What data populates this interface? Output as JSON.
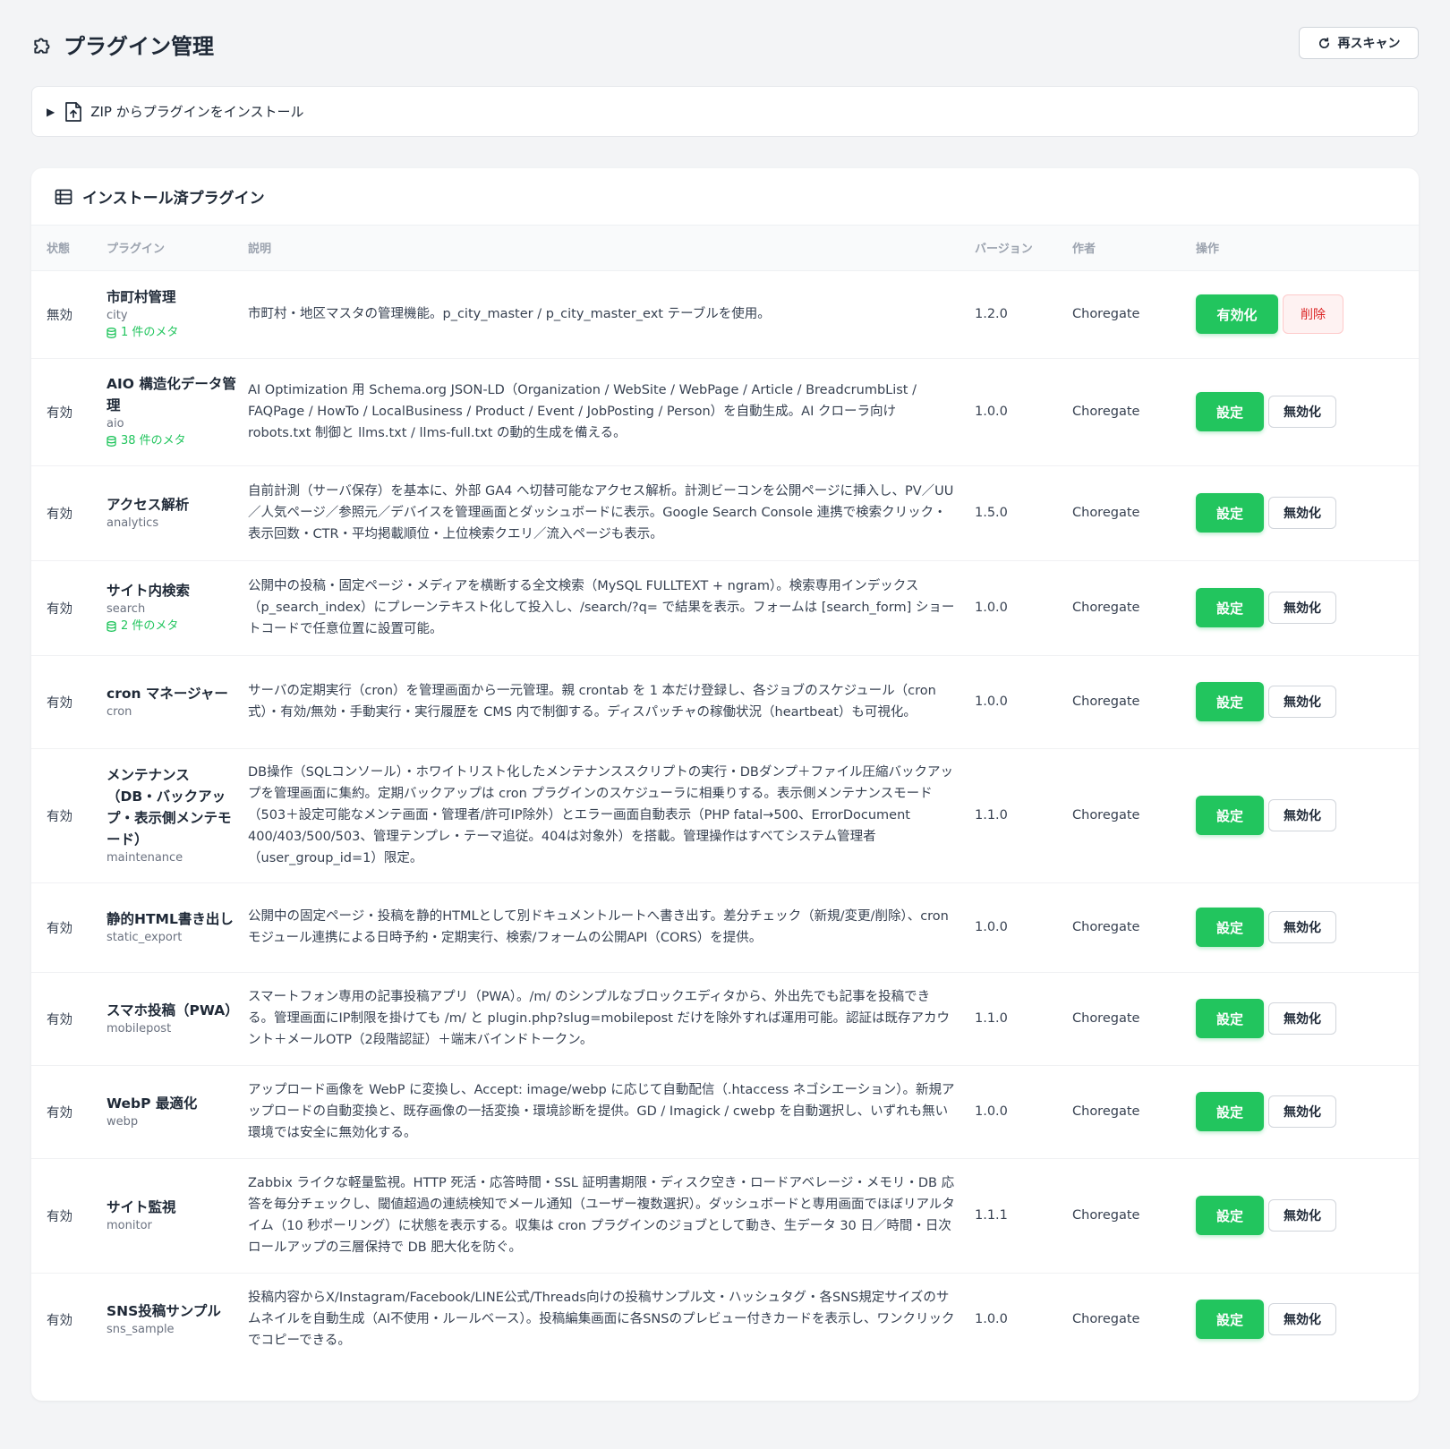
{
  "header": {
    "title": "プラグイン管理",
    "rescan_label": "再スキャン"
  },
  "zip_install": {
    "label": "ZIP からプラグインをインストール"
  },
  "installed": {
    "title": "インストール済プラグイン",
    "columns": [
      "状態",
      "プラグイン",
      "説明",
      "バージョン",
      "作者",
      "操作"
    ],
    "rows": [
      {
        "status": "無効",
        "name": "市町村管理",
        "slug": "city",
        "meta": "1 件のメタ",
        "description": "市町村・地区マスタの管理機能。p_city_master / p_city_master_ext テーブルを使用。",
        "version": "1.2.0",
        "author": "Choregate",
        "primary_action": "有効化",
        "secondary_action": "削除"
      },
      {
        "status": "有効",
        "name": "AIO 構造化データ管理",
        "slug": "aio",
        "meta": "38 件のメタ",
        "description": "AI Optimization 用 Schema.org JSON-LD（Organization / WebSite / WebPage / Article / BreadcrumbList / FAQPage / HowTo / LocalBusiness / Product / Event / JobPosting / Person）を自動生成。AI クローラ向け robots.txt 制御と llms.txt / llms-full.txt の動的生成を備える。",
        "version": "1.0.0",
        "author": "Choregate",
        "primary_action": "設定",
        "secondary_action": "無効化"
      },
      {
        "status": "有効",
        "name": "アクセス解析",
        "slug": "analytics",
        "meta": "",
        "description": "自前計測（サーバ保存）を基本に、外部 GA4 へ切替可能なアクセス解析。計測ビーコンを公開ページに挿入し、PV／UU／人気ページ／参照元／デバイスを管理画面とダッシュボードに表示。Google Search Console 連携で検索クリック・表示回数・CTR・平均掲載順位・上位検索クエリ／流入ページも表示。",
        "version": "1.5.0",
        "author": "Choregate",
        "primary_action": "設定",
        "secondary_action": "無効化"
      },
      {
        "status": "有効",
        "name": "サイト内検索",
        "slug": "search",
        "meta": "2 件のメタ",
        "description": "公開中の投稿・固定ページ・メディアを横断する全文検索（MySQL FULLTEXT + ngram）。検索専用インデックス（p_search_index）にプレーンテキスト化して投入し、/search/?q= で結果を表示。フォームは [search_form] ショートコードで任意位置に設置可能。",
        "version": "1.0.0",
        "author": "Choregate",
        "primary_action": "設定",
        "secondary_action": "無効化"
      },
      {
        "status": "有効",
        "name": "cron マネージャー",
        "slug": "cron",
        "meta": "",
        "description": "サーバの定期実行（cron）を管理画面から一元管理。親 crontab を 1 本だけ登録し、各ジョブのスケジュール（cron 式）・有効/無効・手動実行・実行履歴を CMS 内で制御する。ディスパッチャの稼働状況（heartbeat）も可視化。",
        "version": "1.0.0",
        "author": "Choregate",
        "primary_action": "設定",
        "secondary_action": "無効化"
      },
      {
        "status": "有効",
        "name": "メンテナンス（DB・バックアップ・表示側メンテモード）",
        "slug": "maintenance",
        "meta": "",
        "description": "DB操作（SQLコンソール）・ホワイトリスト化したメンテナンススクリプトの実行・DBダンプ＋ファイル圧縮バックアップを管理画面に集約。定期バックアップは cron プラグインのスケジューラに相乗りする。表示側メンテナンスモード（503＋設定可能なメンテ画面・管理者/許可IP除外）とエラー画面自動表示（PHP fatal→500、ErrorDocument 400/403/500/503、管理テンプレ・テーマ追従。404は対象外）を搭載。管理操作はすべてシステム管理者（user_group_id=1）限定。",
        "version": "1.1.0",
        "author": "Choregate",
        "primary_action": "設定",
        "secondary_action": "無効化"
      },
      {
        "status": "有効",
        "name": "静的HTML書き出し",
        "slug": "static_export",
        "meta": "",
        "description": "公開中の固定ページ・投稿を静的HTMLとして別ドキュメントルートへ書き出す。差分チェック（新規/変更/削除）、cron モジュール連携による日時予約・定期実行、検索/フォームの公開API（CORS）を提供。",
        "version": "1.0.0",
        "author": "Choregate",
        "primary_action": "設定",
        "secondary_action": "無効化"
      },
      {
        "status": "有効",
        "name": "スマホ投稿（PWA）",
        "slug": "mobilepost",
        "meta": "",
        "description": "スマートフォン専用の記事投稿アプリ（PWA）。/m/ のシンプルなブロックエディタから、外出先でも記事を投稿できる。管理画面にIP制限を掛けても /m/ と plugin.php?slug=mobilepost だけを除外すれば運用可能。認証は既存アカウント＋メールOTP（2段階認証）＋端末バインドトークン。",
        "version": "1.1.0",
        "author": "Choregate",
        "primary_action": "設定",
        "secondary_action": "無効化"
      },
      {
        "status": "有効",
        "name": "WebP 最適化",
        "slug": "webp",
        "meta": "",
        "description": "アップロード画像を WebP に変換し、Accept: image/webp に応じて自動配信（.htaccess ネゴシエーション）。新規アップロードの自動変換と、既存画像の一括変換・環境診断を提供。GD / Imagick / cwebp を自動選択し、いずれも無い環境では安全に無効化する。",
        "version": "1.0.0",
        "author": "Choregate",
        "primary_action": "設定",
        "secondary_action": "無効化"
      },
      {
        "status": "有効",
        "name": "サイト監視",
        "slug": "monitor",
        "meta": "",
        "description": "Zabbix ライクな軽量監視。HTTP 死活・応答時間・SSL 証明書期限・ディスク空き・ロードアベレージ・メモリ・DB 応答を毎分チェックし、閾値超過の連続検知でメール通知（ユーザー複数選択）。ダッシュボードと専用画面でほぼリアルタイム（10 秒ポーリング）に状態を表示する。収集は cron プラグインのジョブとして動き、生データ 30 日／時間・日次ロールアップの三層保持で DB 肥大化を防ぐ。",
        "version": "1.1.1",
        "author": "Choregate",
        "primary_action": "設定",
        "secondary_action": "無効化"
      },
      {
        "status": "有効",
        "name": "SNS投稿サンプル",
        "slug": "sns_sample",
        "meta": "",
        "description": "投稿内容からX/Instagram/Facebook/LINE公式/Threads向けの投稿サンプル文・ハッシュタグ・各SNS規定サイズのサムネイルを自動生成（AI不使用・ルールベース）。投稿編集画面に各SNSのプレビュー付きカードを表示し、ワンクリックでコピーできる。",
        "version": "1.0.0",
        "author": "Choregate",
        "primary_action": "設定",
        "secondary_action": "無効化"
      }
    ]
  },
  "colors": {
    "accent": "#22c55e",
    "danger": "#dc2626",
    "background": "#f3f4f6"
  },
  "icons": {
    "title": "puzzle-icon",
    "rescan": "refresh-icon",
    "zip": "file-upload-icon",
    "installed": "table-icon",
    "meta": "database-icon"
  }
}
